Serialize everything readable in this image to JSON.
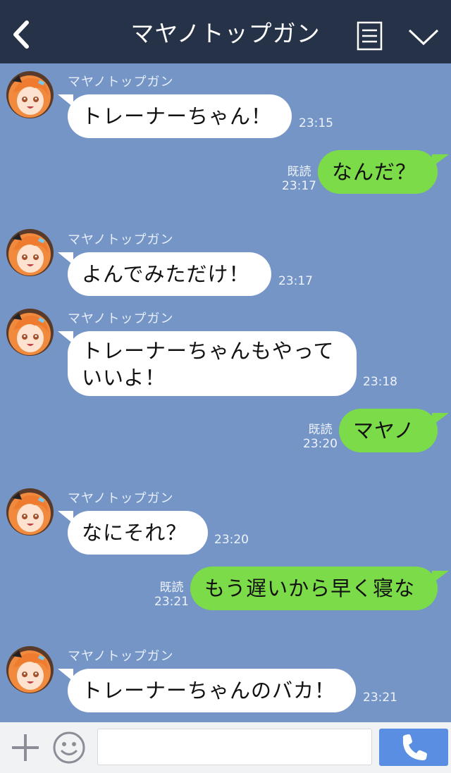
{
  "header": {
    "title": "マヤノトップガン",
    "icons": {
      "back": "chevron-left-icon",
      "menu": "menu-lines-icon",
      "dropdown": "chevron-down-icon"
    }
  },
  "colors": {
    "header_bg": "#253247",
    "chat_bg": "#7495c6",
    "incoming_bubble": "#ffffff",
    "outgoing_bubble": "#7bdb49",
    "call_button": "#5a8ee2"
  },
  "messages": [
    {
      "direction": "in",
      "sender": "マヤノトップガン",
      "text": "トレーナーちゃん！",
      "time": "23:15"
    },
    {
      "direction": "out",
      "text": "なんだ？",
      "read": "既読",
      "time": "23:17"
    },
    {
      "direction": "in",
      "sender": "マヤノトップガン",
      "text": "よんでみただけ！",
      "time": "23:17"
    },
    {
      "direction": "in",
      "sender": "マヤノトップガン",
      "text_line1": "トレーナーちゃんもやって",
      "text_line2": "いいよ！",
      "time": "23:18"
    },
    {
      "direction": "out",
      "text": "マヤノ",
      "read": "既読",
      "time": "23:20"
    },
    {
      "direction": "in",
      "sender": "マヤノトップガン",
      "text": "なにそれ？",
      "time": "23:20"
    },
    {
      "direction": "out",
      "text": "もう遅いから早く寝な",
      "read": "既読",
      "time": "23:21"
    },
    {
      "direction": "in",
      "sender": "マヤノトップガン",
      "text": "トレーナーちゃんのバカ！",
      "time": "23:21"
    }
  ],
  "input": {
    "value": "",
    "placeholder": ""
  },
  "toolbar": {
    "icons": {
      "plus": "plus-icon",
      "emoji": "smiley-icon",
      "call": "phone-icon"
    }
  }
}
